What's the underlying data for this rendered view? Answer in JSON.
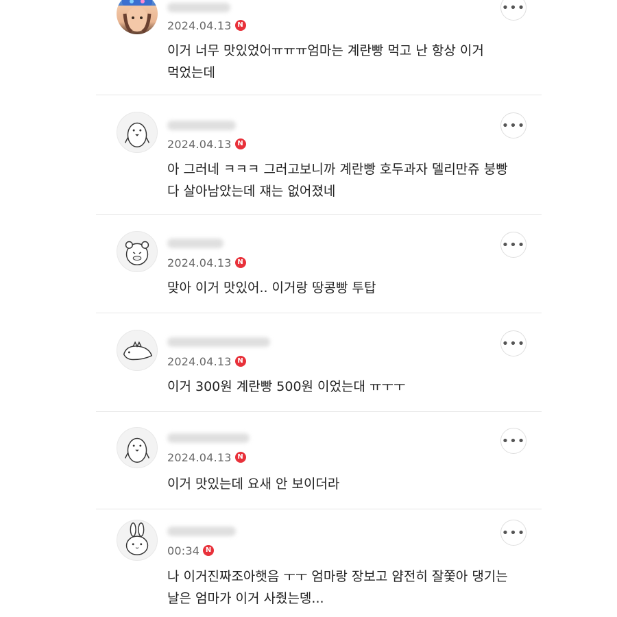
{
  "comments": [
    {
      "date": "2024.04.13",
      "badge": "N",
      "avatar_icon": "child-photo-avatar-icon",
      "more_label": "•••",
      "text": "이거 너무 맛있었어ㅠㅠㅠ엄마는 계란빵 먹고 난 항상 이거 먹었는데"
    },
    {
      "date": "2024.04.13",
      "badge": "N",
      "avatar_icon": "penguin-avatar-icon",
      "more_label": "•••",
      "text": "아 그러네 ㅋㅋㅋ 그러고보니까 계란빵 호두과자 델리만쥬 붕빵 다 살아남았는데 쟤는 없어졌네"
    },
    {
      "date": "2024.04.13",
      "badge": "N",
      "avatar_icon": "bear-avatar-icon",
      "more_label": "•••",
      "text": "맞아 이거 맛있어.. 이거랑 땅콩빵 투탑"
    },
    {
      "date": "2024.04.13",
      "badge": "N",
      "avatar_icon": "dinosaur-avatar-icon",
      "more_label": "•••",
      "text": "이거 300원 계란빵 500원 이었는대 ㅠㅜㅜ"
    },
    {
      "date": "2024.04.13",
      "badge": "N",
      "avatar_icon": "penguin-avatar-icon",
      "more_label": "•••",
      "text": "이거 맛있는데 요새 안 보이더라"
    },
    {
      "date": "00:34",
      "badge": "N",
      "avatar_icon": "rabbit-avatar-icon",
      "more_label": "•••",
      "text": "나 이거진짜조아햇음 ㅜㅜ 엄마랑 장보고 얌전히 잘쫓아 댕기는 날은 엄마가 이거 사줬는뎅..."
    }
  ]
}
